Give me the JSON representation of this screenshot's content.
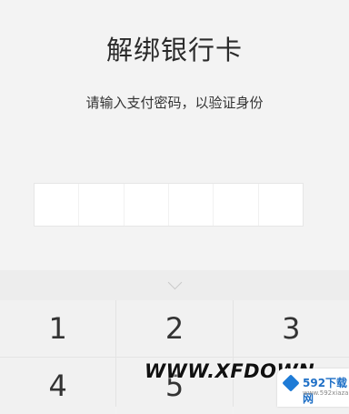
{
  "header": {
    "title": "解绑银行卡",
    "subtitle": "请输入支付密码，以验证身份"
  },
  "pin": {
    "digits_total": 6,
    "digits_entered": 0
  },
  "keyboard": {
    "keys": [
      "1",
      "2",
      "3",
      "4",
      "5",
      ""
    ]
  },
  "watermark": {
    "text": "WWW.XFDOWN",
    "badge": "592下载网",
    "badge_small": "www.592xiazai.com"
  }
}
